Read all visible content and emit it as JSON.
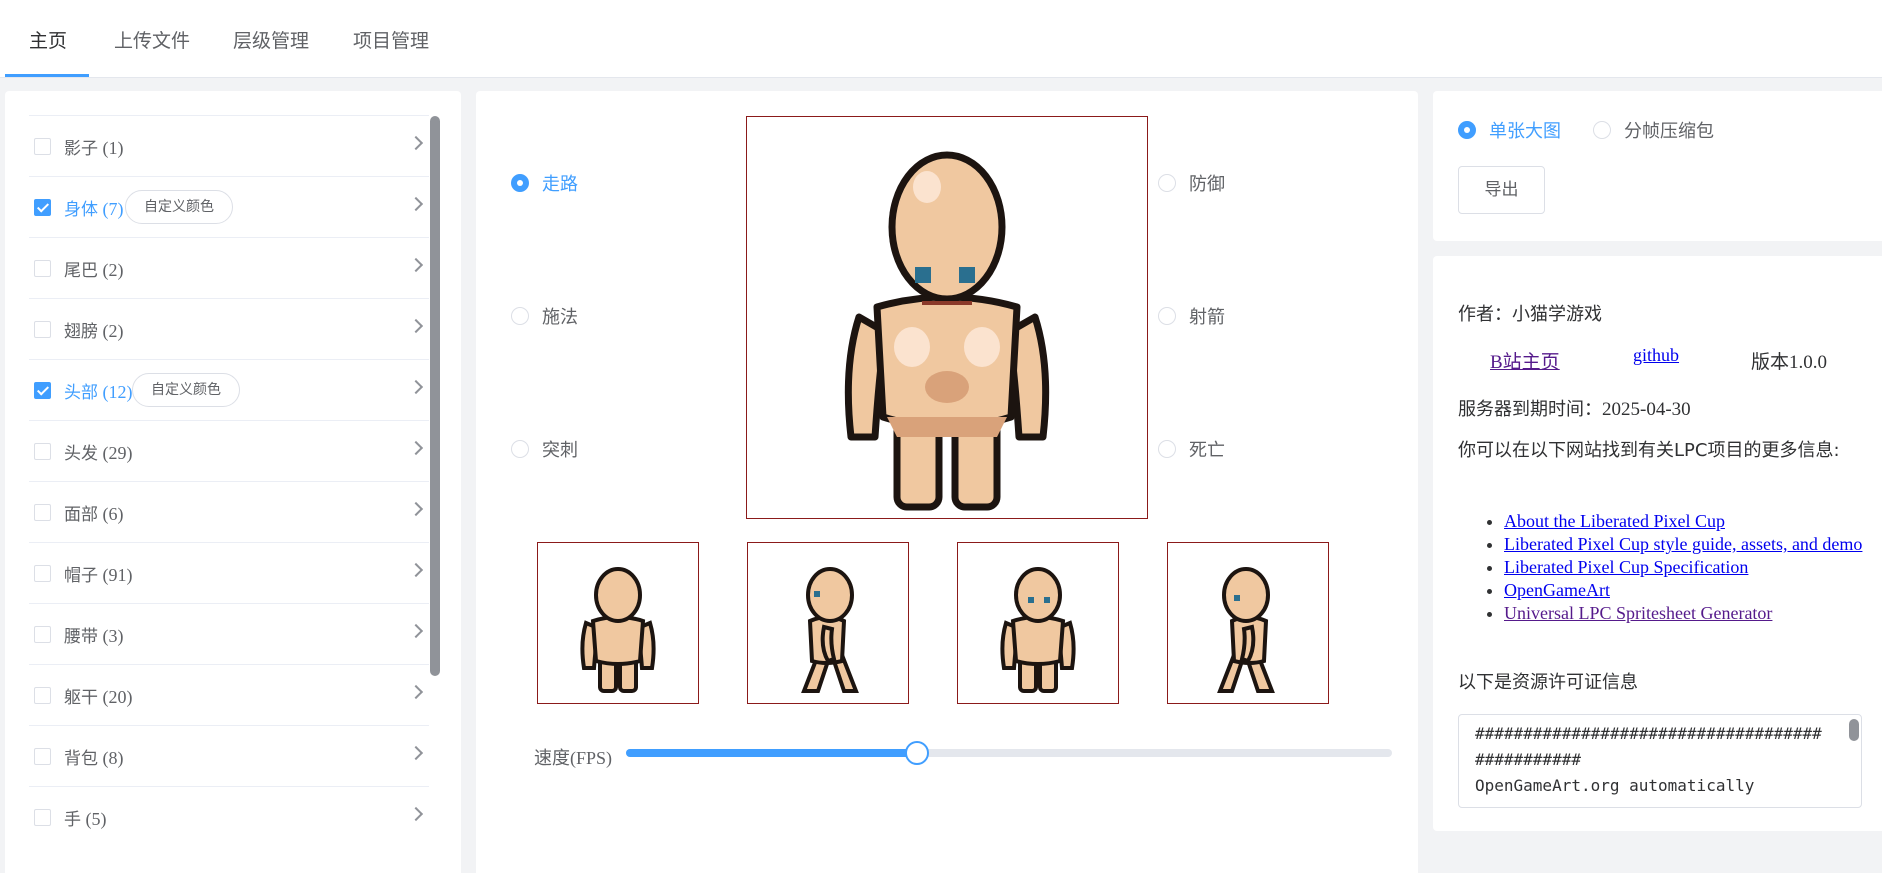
{
  "tabs": [
    {
      "label": "主页",
      "active": true
    },
    {
      "label": "上传文件",
      "active": false
    },
    {
      "label": "层级管理",
      "active": false
    },
    {
      "label": "项目管理",
      "active": false
    }
  ],
  "categories": [
    {
      "name": "影子",
      "count": "(1)",
      "checked": false,
      "color_button": ""
    },
    {
      "name": "身体",
      "count": "(7)",
      "checked": true,
      "color_button": "自定义颜色"
    },
    {
      "name": "尾巴",
      "count": "(2)",
      "checked": false,
      "color_button": ""
    },
    {
      "name": "翅膀",
      "count": "(2)",
      "checked": false,
      "color_button": ""
    },
    {
      "name": "头部",
      "count": "(12)",
      "checked": true,
      "color_button": "自定义颜色"
    },
    {
      "name": "头发",
      "count": "(29)",
      "checked": false,
      "color_button": ""
    },
    {
      "name": "面部",
      "count": "(6)",
      "checked": false,
      "color_button": ""
    },
    {
      "name": "帽子",
      "count": "(91)",
      "checked": false,
      "color_button": ""
    },
    {
      "name": "腰带",
      "count": "(3)",
      "checked": false,
      "color_button": ""
    },
    {
      "name": "躯干",
      "count": "(20)",
      "checked": false,
      "color_button": ""
    },
    {
      "name": "背包",
      "count": "(8)",
      "checked": false,
      "color_button": ""
    },
    {
      "name": "手",
      "count": "(5)",
      "checked": false,
      "color_button": ""
    }
  ],
  "animations": {
    "walk": "走路",
    "cast": "施法",
    "thrust": "突刺",
    "defend": "防御",
    "shoot": "射箭",
    "die": "死亡",
    "selected": "walk"
  },
  "speed": {
    "label": "速度(FPS)",
    "value_fraction": 0.38
  },
  "export": {
    "option_single": "单张大图",
    "option_frames": "分帧压缩包",
    "selected": "single",
    "button": "导出"
  },
  "info": {
    "author": "作者：小猫学游戏",
    "bilibili": "B站主页",
    "github": "github",
    "version": "版本1.0.0",
    "server_expiry_label": "服务器到期时间：",
    "server_expiry_date": "2025-04-30",
    "more_info": "你可以在以下网站找到有关LPC项目的更多信息:",
    "links": [
      "About the Liberated Pixel Cup",
      "Liberated Pixel Cup style guide, assets, and demo",
      "Liberated Pixel Cup Specification",
      "OpenGameArt",
      "Universal LPC Spritesheet Generator"
    ],
    "license_heading": "以下是资源许可证信息",
    "license_lines": [
      "####################################",
      "###########",
      "OpenGameArt.org automatically"
    ]
  },
  "colors": {
    "accent": "#409eff",
    "frame": "#8b1a1a",
    "skin": "#f2c9a3"
  }
}
